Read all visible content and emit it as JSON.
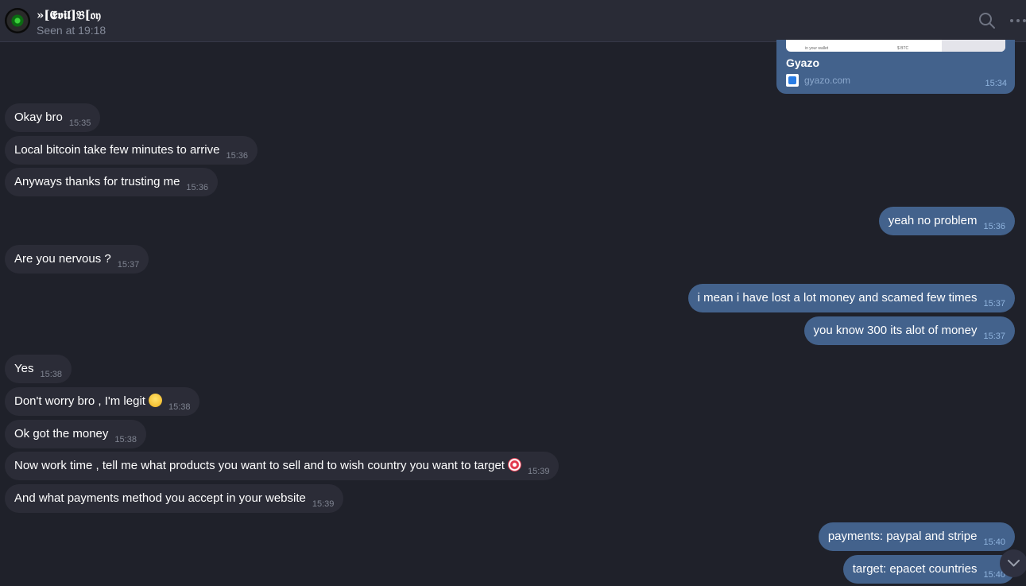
{
  "header": {
    "name": "»[𝕰𝖛𝖎𝖑]𝔅[𝔬𝔶",
    "status": "Seen at 19:18"
  },
  "link_preview": {
    "preview_left_text": "in your wallet",
    "preview_right_text": "$ BTC",
    "title": "Gyazo",
    "domain": "gyazo.com",
    "time": "15:34"
  },
  "messages": [
    {
      "dir": "in",
      "text": "Okay bro",
      "time": "15:35"
    },
    {
      "dir": "in",
      "text": "Local bitcoin take few minutes to arrive",
      "time": "15:36"
    },
    {
      "dir": "in",
      "text": "Anyways thanks for trusting me",
      "time": "15:36"
    },
    {
      "dir": "out",
      "text": "yeah no problem",
      "time": "15:36"
    },
    {
      "dir": "in",
      "text": "Are you nervous ?",
      "time": "15:37"
    },
    {
      "dir": "out",
      "text": "i mean i have lost a lot money and scamed few times",
      "time": "15:37"
    },
    {
      "dir": "out",
      "text": "you know 300 its alot of money",
      "time": "15:37"
    },
    {
      "dir": "in",
      "text": "Yes",
      "time": "15:38"
    },
    {
      "dir": "in",
      "text": "Don't worry bro , I'm legit",
      "time": "15:38",
      "emoji": "smiling-face"
    },
    {
      "dir": "in",
      "text": "Ok got the money",
      "time": "15:38"
    },
    {
      "dir": "in",
      "text": "Now work time , tell me what products you want to sell and to wish country you want to target",
      "time": "15:39",
      "emoji": "target"
    },
    {
      "dir": "in",
      "text": "And what payments method you accept in your website",
      "time": "15:39"
    },
    {
      "dir": "out",
      "text": "payments: paypal and stripe",
      "time": "15:40"
    },
    {
      "dir": "out",
      "text": "target: epacet countries",
      "time": "15:40"
    }
  ],
  "icons": {
    "search": "search-icon",
    "more": "more-dots-icon",
    "scroll": "chevron-down-icon"
  },
  "colors": {
    "background": "#1f212a",
    "header": "#292b36",
    "incoming_bubble": "#2b2c37",
    "outgoing_bubble": "#43628c"
  }
}
